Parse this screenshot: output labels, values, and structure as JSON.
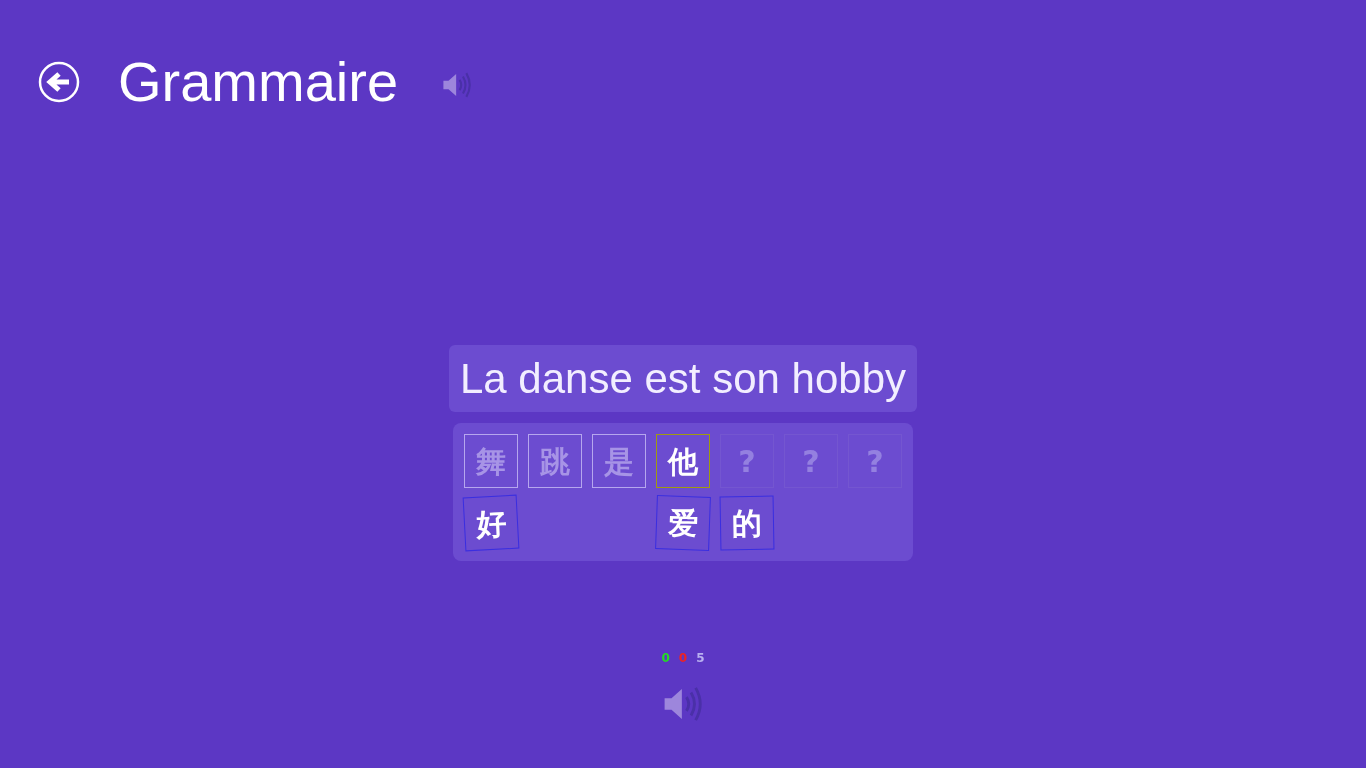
{
  "header": {
    "title": "Grammaire"
  },
  "sentence": "La danse est son hobby",
  "answer_slots": [
    {
      "kind": "filled",
      "char": "舞"
    },
    {
      "kind": "filled",
      "char": "跳"
    },
    {
      "kind": "filled",
      "char": "是"
    },
    {
      "kind": "current",
      "char": "他"
    },
    {
      "kind": "empty",
      "char": "?"
    },
    {
      "kind": "empty",
      "char": "?"
    },
    {
      "kind": "empty",
      "char": "?"
    }
  ],
  "choices": [
    {
      "char": "好"
    },
    {
      "char": "爱"
    },
    {
      "char": "的"
    }
  ],
  "score": [
    {
      "value": "0",
      "color": "#22dd22"
    },
    {
      "value": "0",
      "color": "#ee2222"
    },
    {
      "value": "5",
      "color": "#b8b0f0"
    }
  ]
}
